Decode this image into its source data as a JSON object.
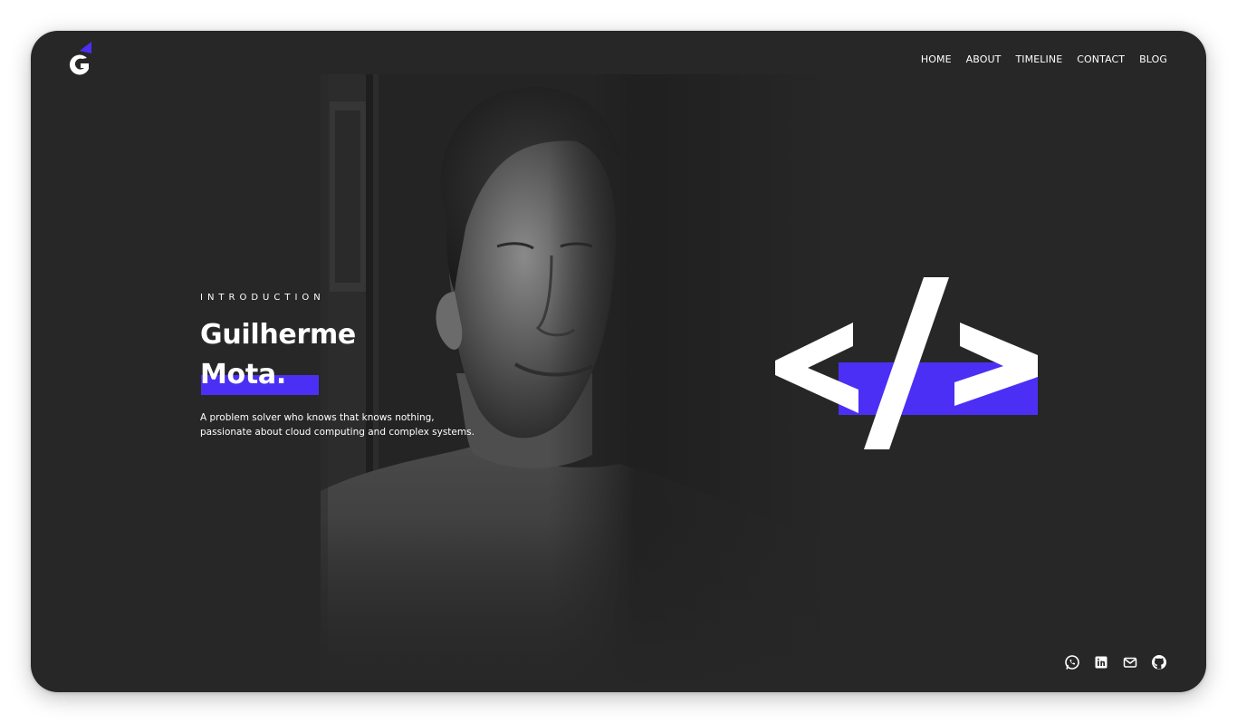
{
  "theme": {
    "background": "#272727",
    "accent": "#4b2ff5",
    "text": "#ffffff"
  },
  "logo": {
    "icon": "g-logo-icon",
    "letter": "G"
  },
  "nav": {
    "items": [
      {
        "label": "HOME"
      },
      {
        "label": "ABOUT"
      },
      {
        "label": "TIMELINE"
      },
      {
        "label": "CONTACT"
      },
      {
        "label": "BLOG"
      }
    ]
  },
  "hero": {
    "kicker": "INTRODUCTION",
    "name_first": "Guilherme",
    "name_last": "Mota.",
    "bio_line1": "A problem solver who knows that knows nothing,",
    "bio_line2": "passionate about cloud computing and complex systems.",
    "portrait": "black-and-white-portrait-photo",
    "code_symbol_icon": "code-brackets-icon"
  },
  "social": {
    "icons": [
      "whatsapp-icon",
      "linkedin-icon",
      "mail-icon",
      "github-icon"
    ]
  }
}
